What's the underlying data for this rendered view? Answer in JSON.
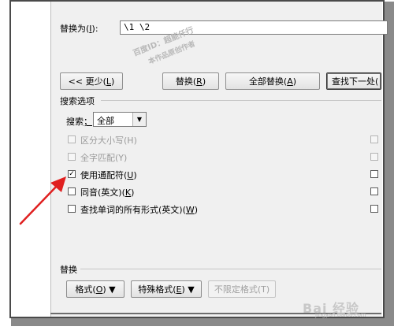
{
  "replace": {
    "label_prefix": "替换为(",
    "label_key": "I",
    "label_suffix": "):",
    "value": "\\1  \\2"
  },
  "watermark": {
    "line1": "百度ID：超能仟行",
    "line2": "本作品原创作者"
  },
  "buttons": {
    "less_prefix": "<< 更少(",
    "less_key": "L",
    "less_suffix": ")",
    "replace_prefix": "替换(",
    "replace_key": "R",
    "replace_suffix": ")",
    "replace_all_prefix": "全部替换(",
    "replace_all_key": "A",
    "replace_all_suffix": ")",
    "find_next": "查找下一处("
  },
  "search_options": {
    "title": "搜索选项",
    "search_label": "搜索",
    "search_label_key": "；",
    "search_value": "全部",
    "options": [
      {
        "label": "区分大小写(H)",
        "checked": false,
        "enabled": false
      },
      {
        "label": "全字匹配(Y)",
        "checked": false,
        "enabled": false
      },
      {
        "label_prefix": "使用通配符(",
        "label_key": "U",
        "label_suffix": ")",
        "checked": true,
        "enabled": true
      },
      {
        "label_prefix": "同音(英文)(",
        "label_key": "K",
        "label_suffix": ")",
        "checked": false,
        "enabled": true
      },
      {
        "label_prefix": "查找单词的所有形式(英文)(",
        "label_key": "W",
        "label_suffix": ")",
        "checked": false,
        "enabled": true
      }
    ]
  },
  "replace_section": {
    "title": "替换",
    "format_prefix": "格式(",
    "format_key": "O",
    "format_suffix": ") ▼",
    "special_prefix": "特殊格式(",
    "special_key": "E",
    "special_suffix": ") ▼",
    "no_format": "不限定格式(T)"
  },
  "brand": {
    "logo": "Bai 经验",
    "url": "jingyan.baidu.com"
  },
  "colors": {
    "arrow": "#e02020",
    "dialog_bg": "#f0f0f0"
  }
}
